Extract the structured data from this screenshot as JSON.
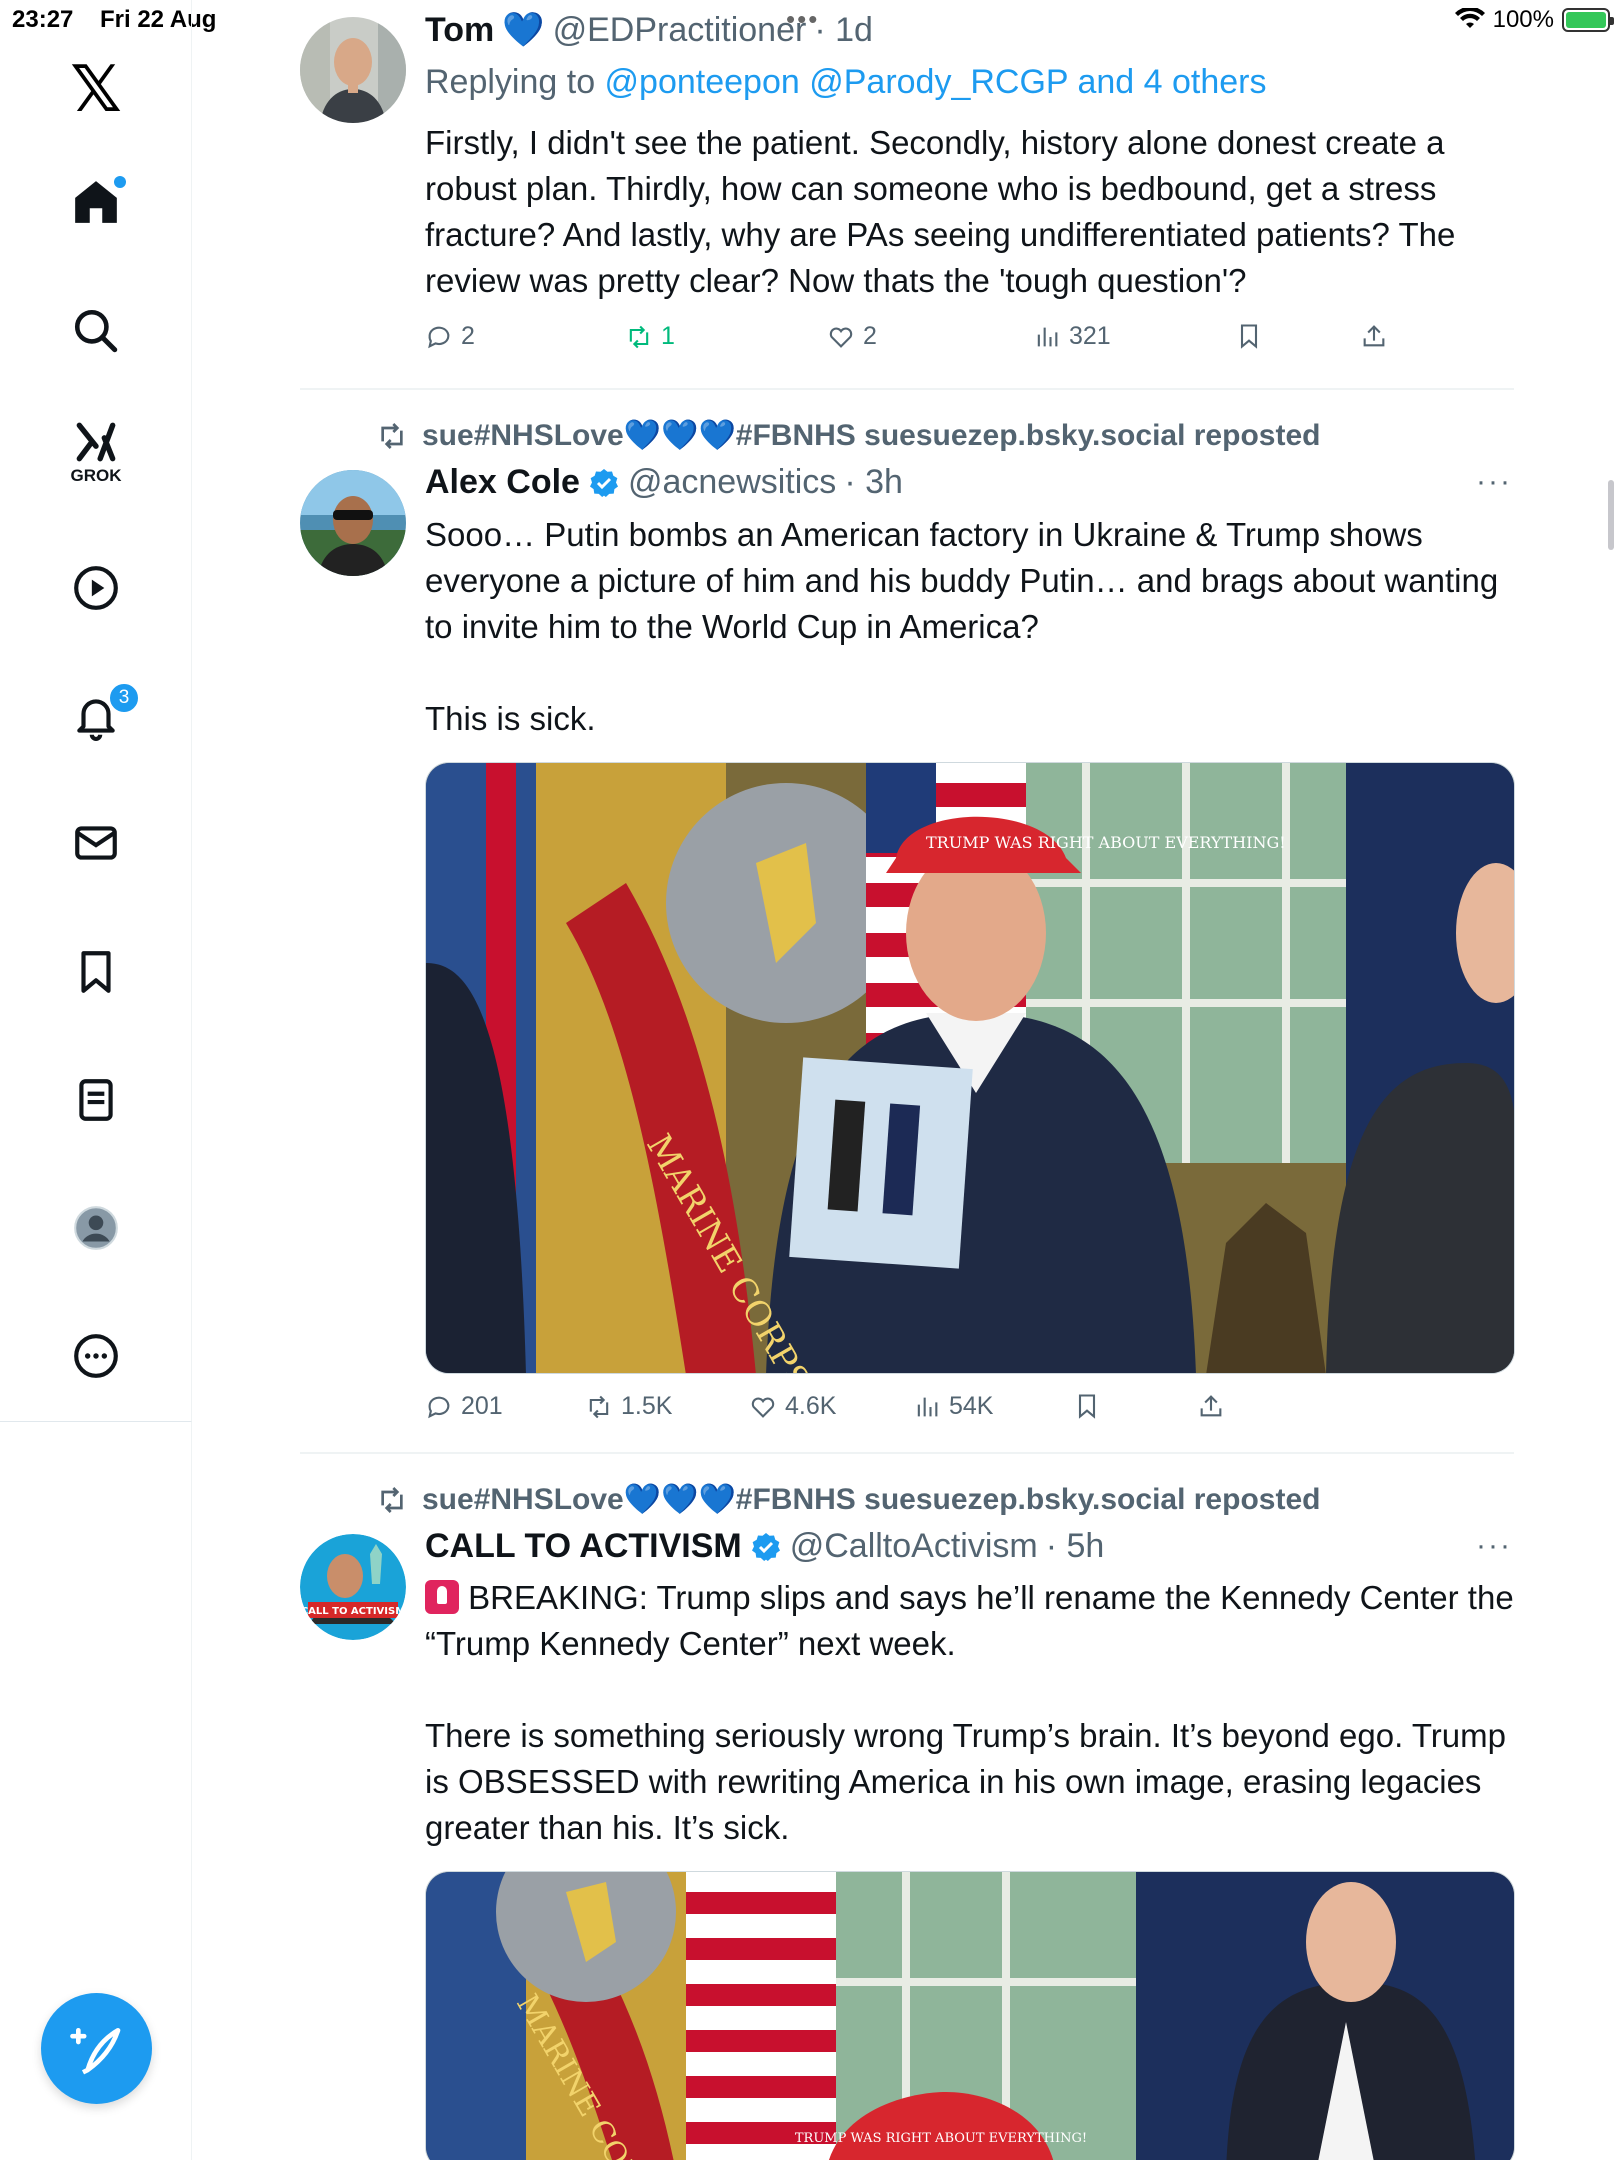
{
  "status_bar": {
    "time": "23:27",
    "date": "Fri 22 Aug",
    "battery": "100%",
    "battery_level": 1.0
  },
  "sidebar": {
    "logo": "𝕏",
    "items": [
      {
        "name": "home",
        "icon": "home-icon",
        "has_dot": true
      },
      {
        "name": "explore",
        "icon": "search-icon"
      },
      {
        "name": "grok",
        "icon": "grok-icon",
        "label": "GROK"
      },
      {
        "name": "video",
        "icon": "play-icon"
      },
      {
        "name": "notifications",
        "icon": "bell-icon",
        "badge": "3"
      },
      {
        "name": "messages",
        "icon": "mail-icon"
      },
      {
        "name": "bookmarks",
        "icon": "bookmark-icon"
      },
      {
        "name": "lists",
        "icon": "list-icon"
      },
      {
        "name": "profile",
        "icon": "profile-icon"
      },
      {
        "name": "more",
        "icon": "more-icon"
      }
    ],
    "compose_icon": "compose-icon"
  },
  "colors": {
    "accent": "#1d9bf0",
    "text": "#0f1419",
    "muted": "#536471",
    "repost_green": "#00ba7c"
  },
  "tweets": [
    {
      "name": "Tom",
      "emoji": "💙",
      "handle": "@EDPractitioner",
      "time": "· 1d",
      "reply_prefix": "Replying to ",
      "reply_to": "@ponteepon @Parody_RCGP and 4 others",
      "text": "Firstly, I didn't see the patient. Secondly, history alone donest create a robust plan. Thirdly, how can someone who is bedbound, get a stress fracture? And lastly, why are PAs seeing undifferentiated patients? The review was pretty clear? Now thats the 'tough question'?",
      "replies": "2",
      "reposts": "1",
      "likes": "2",
      "views": "321"
    },
    {
      "repost_by": "sue#NHSLove💙💙💙#FBNHS suesuezep.bsky.social reposted",
      "name": "Alex Cole",
      "handle": "@acnewsitics",
      "time": "· 3h",
      "text": "Sooo… Putin bombs an American factory in Ukraine & Trump shows everyone a picture of him and his buddy Putin… and brags about wanting to invite him to the World Cup in America?\n\nThis is sick.",
      "image_cap_text": "TRUMP WAS RIGHT ABOUT EVERYTHING!",
      "image_flag_text": "MARINE CORPS",
      "replies": "201",
      "reposts": "1.5K",
      "likes": "4.6K",
      "views": "54K"
    },
    {
      "repost_by": "sue#NHSLove💙💙💙#FBNHS suesuezep.bsky.social reposted",
      "name": "CALL TO ACTIVISM",
      "handle": "@CalltoActivism",
      "time": "· 5h",
      "text_first": "BREAKING: Trump slips and says he’ll rename the Kennedy Center the “Trump Kennedy Center” next week.",
      "text_rest": "There is something seriously wrong Trump’s brain. It’s beyond ego. Trump is OBSESSED with rewriting America in his own image, erasing legacies greater than his. It’s sick.",
      "avatar_text": "CALL TO ACTIVISM",
      "image_cap_text": "TRUMP WAS RIGHT ABOUT EVERYTHING!",
      "image_flag_text": "MARINE CORPS"
    }
  ]
}
